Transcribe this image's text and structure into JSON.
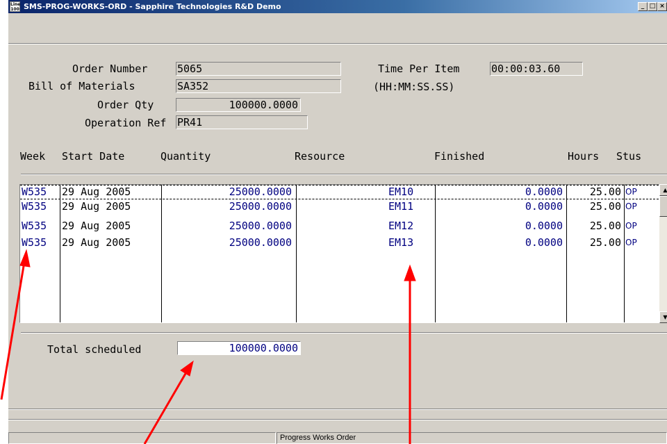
{
  "window": {
    "title": "SMS-PROG-WORKS-ORD - Sapphire Technologies R&D Demo",
    "app_icon_text": "Line 100",
    "minimize": "_",
    "maximize": "□",
    "close": "×"
  },
  "header": {
    "order_number_label": "Order Number",
    "order_number": "5065",
    "bom_label": "Bill of Materials",
    "bom": "SA352",
    "order_qty_label": "Order Qty",
    "order_qty": "100000.0000",
    "operation_ref_label": "Operation Ref",
    "operation_ref": "PR41",
    "time_per_item_label": "Time Per Item",
    "time_per_item": "00:00:03.60",
    "time_format": "(HH:MM:SS.SS)"
  },
  "table": {
    "columns": [
      "Week",
      "Start Date",
      "Quantity",
      "Resource",
      "Finished",
      "Hours",
      "Stus"
    ],
    "rows": [
      {
        "week": "W535",
        "start_date": "29 Aug 2005",
        "quantity": "25000.0000",
        "resource": "EM10",
        "finished": "0.0000",
        "hours": "25.00",
        "status": "OP"
      },
      {
        "week": "W535",
        "start_date": "29 Aug 2005",
        "quantity": "25000.0000",
        "resource": "EM11",
        "finished": "0.0000",
        "hours": "25.00",
        "status": "OP"
      },
      {
        "week": "W535",
        "start_date": "29 Aug 2005",
        "quantity": "25000.0000",
        "resource": "EM12",
        "finished": "0.0000",
        "hours": "25.00",
        "status": "OP"
      },
      {
        "week": "W535",
        "start_date": "29 Aug 2005",
        "quantity": "25000.0000",
        "resource": "EM13",
        "finished": "0.0000",
        "hours": "25.00",
        "status": "OP"
      }
    ]
  },
  "totals": {
    "label": "Total scheduled",
    "value": "100000.0000"
  },
  "status_bar": {
    "panel_2": "Progress Works Order"
  },
  "colors": {
    "window_bg": "#d4d0c8",
    "title_bar": "#0a246a",
    "data_text": "#000080",
    "annotation_arrow": "#ff0000"
  }
}
